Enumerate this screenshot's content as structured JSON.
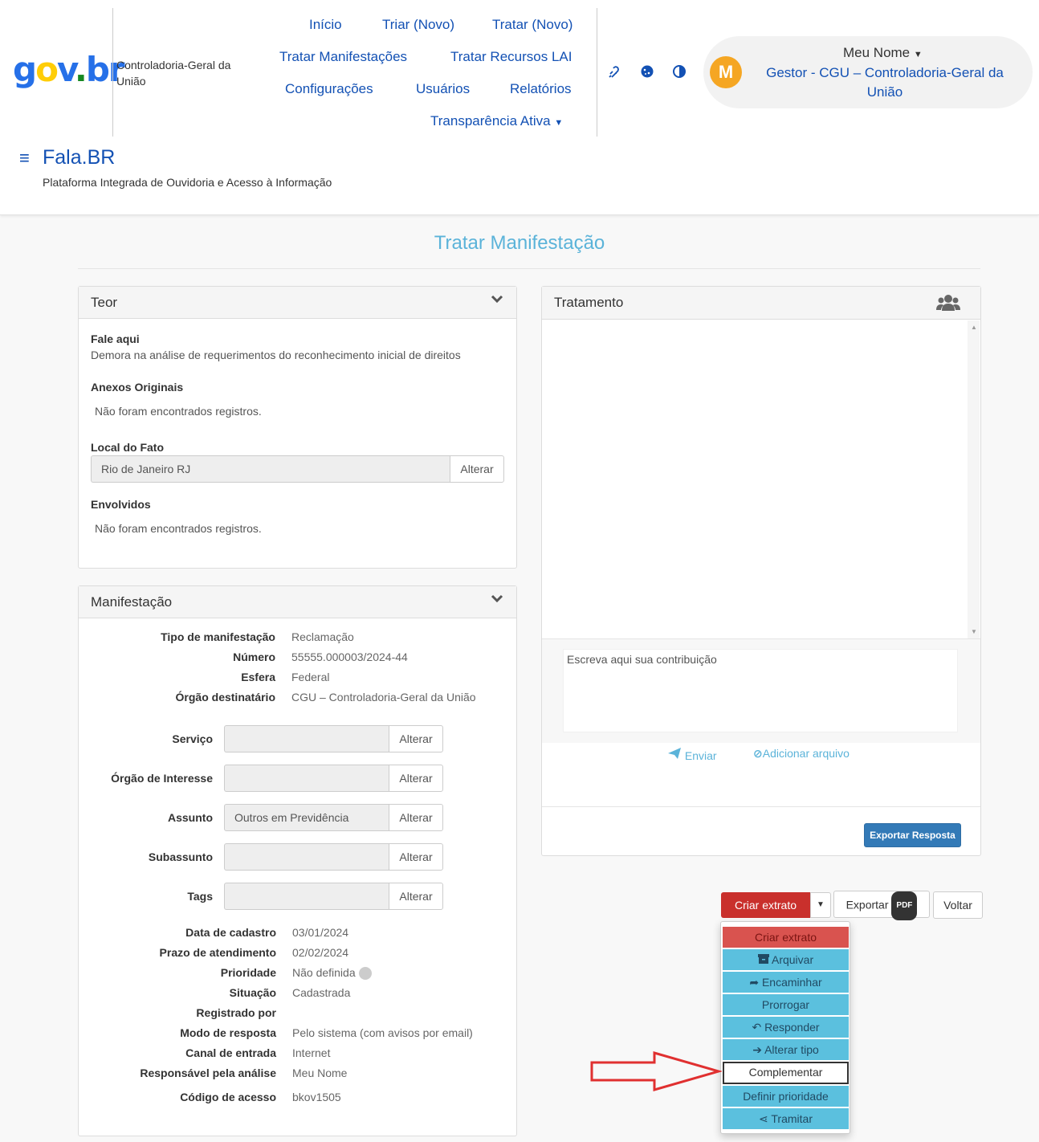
{
  "header": {
    "logo": {
      "g": "g",
      "o": "o",
      "v": "v",
      "dot": ".",
      "br": "br"
    },
    "org": "Controladoria-Geral da União",
    "nav": {
      "inicio": "Início",
      "triar": "Triar (Novo)",
      "tratar": "Tratar (Novo)",
      "tratar_manifestacoes": "Tratar Manifestações",
      "tratar_recursos": "Tratar Recursos LAI",
      "configuracoes": "Configurações",
      "usuarios": "Usuários",
      "relatorios": "Relatórios",
      "transparencia": "Transparência Ativa"
    },
    "user": {
      "avatar": "M",
      "name": "Meu Nome",
      "role": "Gestor - CGU – Controladoria-Geral da União"
    },
    "site_title": "Fala.BR",
    "site_subtitle": "Plataforma Integrada de Ouvidoria e Acesso à Informação"
  },
  "page_title": "Tratar Manifestação",
  "teor": {
    "title": "Teor",
    "fale_aqui_label": "Fale aqui",
    "fale_aqui_text": "Demora na análise de requerimentos do reconhecimento inicial de direitos",
    "anexos_label": "Anexos Originais",
    "anexos_text": "Não foram encontrados registros.",
    "local_label": "Local do Fato",
    "local_value": "Rio de Janeiro RJ",
    "alterar": "Alterar",
    "envolvidos_label": "Envolvidos",
    "envolvidos_text": "Não foram encontrados registros."
  },
  "manifestacao": {
    "title": "Manifestação",
    "tipo_label": "Tipo de manifestação",
    "tipo_value": "Reclamação",
    "numero_label": "Número",
    "numero_value": "55555.000003/2024-44",
    "esfera_label": "Esfera",
    "esfera_value": "Federal",
    "orgao_label": "Órgão destinatário",
    "orgao_value": "CGU – Controladoria-Geral da União",
    "servico_label": "Serviço",
    "servico_value": "",
    "orgao_interesse_label": "Órgão de Interesse",
    "orgao_interesse_value": "",
    "assunto_label": "Assunto",
    "assunto_value": "Outros em Previdência",
    "subassunto_label": "Subassunto",
    "subassunto_value": "",
    "tags_label": "Tags",
    "tags_value": "",
    "alterar": "Alterar",
    "data_label": "Data de cadastro",
    "data_value": "03/01/2024",
    "prazo_label": "Prazo de atendimento",
    "prazo_value": "02/02/2024",
    "prioridade_label": "Prioridade",
    "prioridade_value": "Não definida",
    "situacao_label": "Situação",
    "situacao_value": "Cadastrada",
    "registrado_label": "Registrado por",
    "registrado_value": "",
    "modo_label": "Modo de resposta",
    "modo_value": "Pelo sistema (com avisos por email)",
    "canal_label": "Canal de entrada",
    "canal_value": "Internet",
    "responsavel_label": "Responsável pela análise",
    "responsavel_value": "Meu Nome",
    "codigo_label": "Código de acesso",
    "codigo_value": "bkov1505"
  },
  "tratamento": {
    "title": "Tratamento",
    "placeholder": "Escreva aqui sua contribuição",
    "enviar": "Enviar",
    "adicionar": "Adicionar arquivo",
    "exportar_resposta": "Exportar Resposta"
  },
  "actions": {
    "criar_extrato": "Criar extrato",
    "exportar": "Exportar",
    "pdf": "PDF",
    "voltar": "Voltar"
  },
  "dropdown": {
    "criar_extrato": "Criar extrato",
    "arquivar": "Arquivar",
    "encaminhar": "Encaminhar",
    "prorrogar": "Prorrogar",
    "responder": "Responder",
    "alterar_tipo": "Alterar tipo",
    "complementar": "Complementar",
    "definir_prioridade": "Definir prioridade",
    "tramitar": "Tramitar"
  }
}
